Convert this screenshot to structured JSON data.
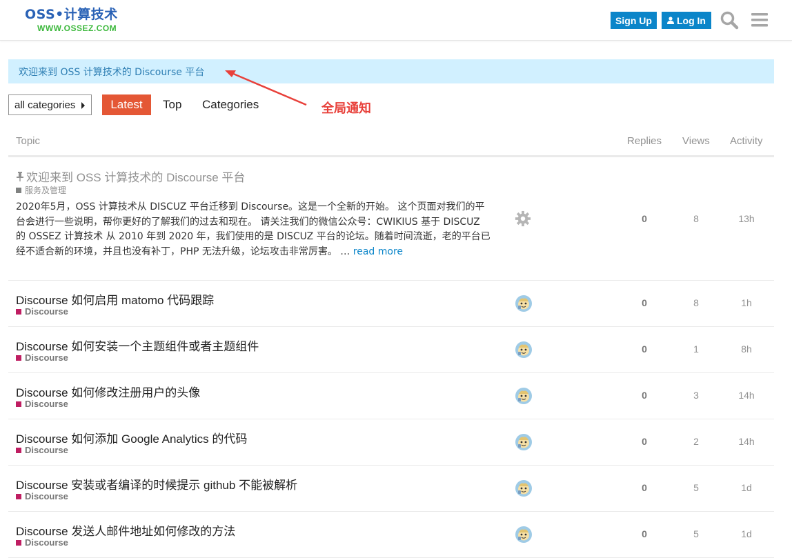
{
  "header": {
    "logo_main": "OSS•计算技术",
    "logo_sub": "WWW.OSSEZ.COM",
    "signup_label": "Sign Up",
    "login_label": "Log In",
    "search_icon": "search-icon",
    "menu_icon": "hamburger-menu-icon"
  },
  "notice": {
    "text": "欢迎来到 OSS 计算技术的 Discourse 平台"
  },
  "annotation": {
    "text": "全局通知",
    "color": "#e8403a"
  },
  "nav": {
    "category_dropdown": "all categories",
    "tabs": [
      {
        "label": "Latest",
        "active": true
      },
      {
        "label": "Top",
        "active": false
      },
      {
        "label": "Categories",
        "active": false
      }
    ]
  },
  "table": {
    "headers": {
      "topic": "Topic",
      "replies": "Replies",
      "views": "Views",
      "activity": "Activity"
    },
    "pinned": {
      "title": "欢迎来到 OSS 计算技术的 Discourse 平台",
      "category": "服务及管理",
      "excerpt": "2020年5月，OSS 计算技术从 DISCUZ 平台迁移到 Discourse。这是一个全新的开始。 这个页面对我们的平台会进行一些说明，帮你更好的了解我们的过去和现在。 请关注我们的微信公众号：CWIKIUS 基于 DISCUZ 的 OSSEZ 计算技术 从 2010 年到 2020 年，我们使用的是 DISCUZ 平台的论坛。随着时间流逝，老的平台已经不适合新的环境，并且也没有补丁，PHP 无法升级，论坛攻击非常厉害。 … ",
      "read_more": "read more",
      "replies": "0",
      "views": "8",
      "activity": "13h"
    },
    "rows": [
      {
        "title": "Discourse 如何启用 matomo 代码跟踪",
        "category": "Discourse",
        "replies": "0",
        "views": "8",
        "activity": "1h"
      },
      {
        "title": "Discourse 如何安装一个主题组件或者主题组件",
        "category": "Discourse",
        "replies": "0",
        "views": "1",
        "activity": "8h"
      },
      {
        "title": "Discourse 如何修改注册用户的头像",
        "category": "Discourse",
        "replies": "0",
        "views": "3",
        "activity": "14h"
      },
      {
        "title": "Discourse 如何添加 Google Analytics 的代码",
        "category": "Discourse",
        "replies": "0",
        "views": "2",
        "activity": "14h"
      },
      {
        "title": "Discourse 安装或者编译的时候提示 github 不能被解析",
        "category": "Discourse",
        "replies": "0",
        "views": "5",
        "activity": "1d"
      },
      {
        "title": "Discourse 发送人邮件地址如何修改的方法",
        "category": "Discourse",
        "replies": "0",
        "views": "5",
        "activity": "1d"
      }
    ]
  },
  "colors": {
    "primary": "#0b85c9",
    "latest_tab": "#e45735",
    "notice_bg": "#d1f0ff",
    "discourse_category": "#bf1e62",
    "service_category": "#808281"
  }
}
